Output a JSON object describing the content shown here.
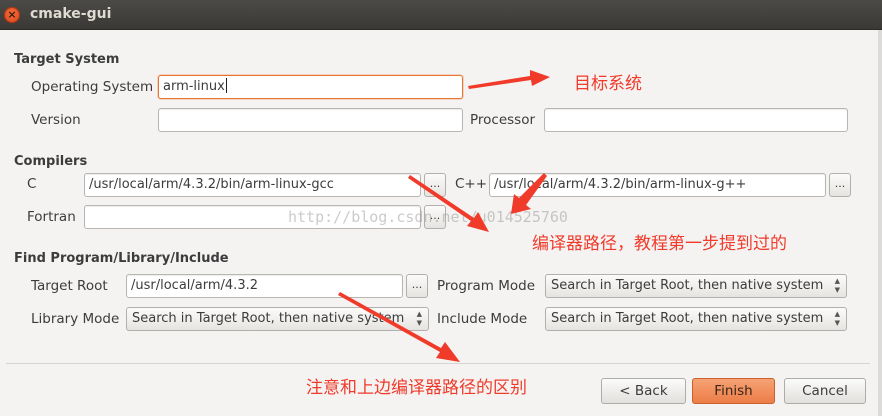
{
  "window": {
    "title": "cmake-gui",
    "close_glyph": "×"
  },
  "target_system": {
    "heading": "Target System",
    "os_label": "Operating System",
    "os_value": "arm-linux",
    "version_label": "Version",
    "version_value": "",
    "processor_label": "Processor",
    "processor_value": ""
  },
  "compilers": {
    "heading": "Compilers",
    "c_label": "C",
    "c_value": "/usr/local/arm/4.3.2/bin/arm-linux-gcc",
    "cxx_label": "C++",
    "cxx_value": "/usr/local/arm/4.3.2/bin/arm-linux-g++",
    "fortran_label": "Fortran",
    "fortran_value": ""
  },
  "find": {
    "heading": "Find Program/Library/Include",
    "target_root_label": "Target Root",
    "target_root_value": "/usr/local/arm/4.3.2",
    "program_mode_label": "Program Mode",
    "program_mode_value": "Search in Target Root, then native system",
    "library_mode_label": "Library Mode",
    "library_mode_value": "Search in Target Root, then native system",
    "include_mode_label": "Include Mode",
    "include_mode_value": "Search in Target Root, then native system"
  },
  "browse_glyph": "...",
  "buttons": {
    "back": "< Back",
    "finish": "Finish",
    "cancel": "Cancel"
  },
  "annotations": {
    "target": "目标系统",
    "compiler_path": "编译器路径，教程第一步提到过的",
    "difference": "注意和上边编译器路径的区别",
    "watermark": "http://blog.csdn.net/u014525760",
    "color": "#f03a2a"
  }
}
